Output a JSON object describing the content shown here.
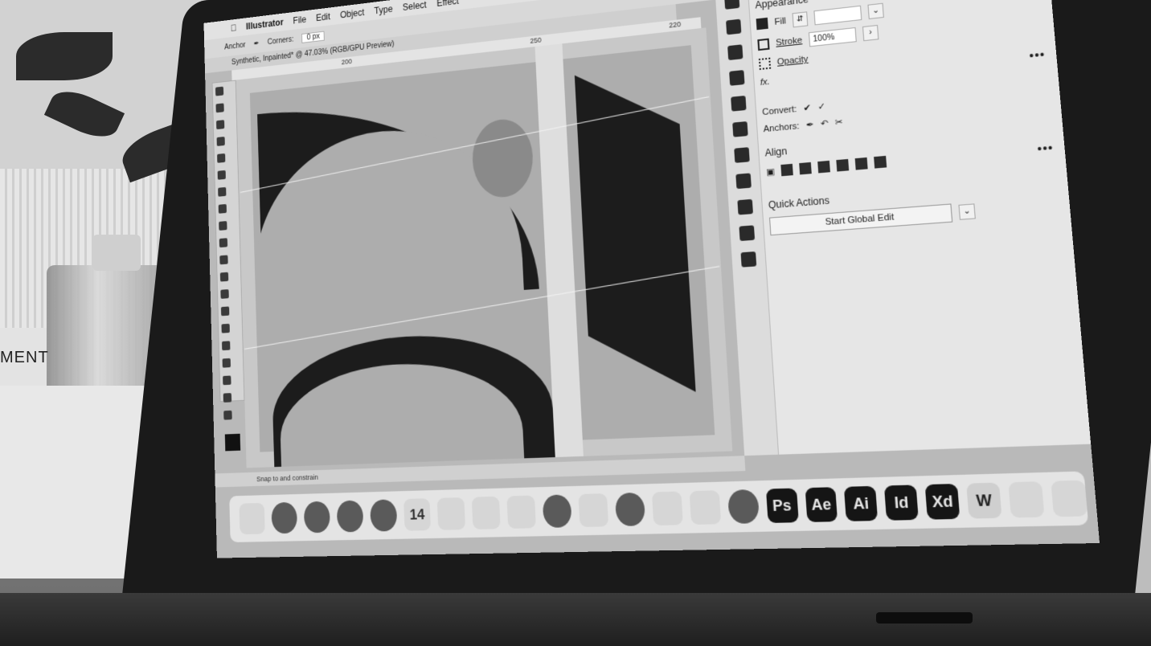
{
  "background": {
    "label_card_text": "MENT"
  },
  "menubar": {
    "items": [
      "Illustrator",
      "File",
      "Edit",
      "Object",
      "Type",
      "Select",
      "Effect"
    ]
  },
  "controlbar": {
    "items": [
      "Anchor",
      "Corners:",
      "0 px"
    ]
  },
  "docbar": {
    "title": "Synthetic, Inpainted* @ 47.03% (RGB/GPU Preview)"
  },
  "ruler": {
    "ticks": [
      "200",
      "250",
      "220"
    ]
  },
  "properties": {
    "appearance_title": "Appearance",
    "fill_label": "Fill",
    "stroke_label": "Stroke",
    "opacity_label": "Opacity",
    "opacity_value": "100%",
    "fx_label": "fx.",
    "convert_label": "Convert:",
    "anchors_label": "Anchors:",
    "align_title": "Align",
    "quick_actions_title": "Quick Actions",
    "start_global_edit": "Start Global Edit"
  },
  "statusbar": {
    "text": "Snap to and constrain"
  },
  "dock": {
    "icons": [
      {
        "name": "finder-icon",
        "label": ""
      },
      {
        "name": "launchpad-icon",
        "label": ""
      },
      {
        "name": "safari-icon",
        "label": ""
      },
      {
        "name": "messages-icon",
        "label": ""
      },
      {
        "name": "chrome-icon",
        "label": ""
      },
      {
        "name": "calendar-icon",
        "label": "14"
      },
      {
        "name": "notes-icon",
        "label": ""
      },
      {
        "name": "reminders-icon",
        "label": ""
      },
      {
        "name": "maps-icon",
        "label": ""
      },
      {
        "name": "photos-icon",
        "label": ""
      },
      {
        "name": "facetime-icon",
        "label": ""
      },
      {
        "name": "spotify-icon",
        "label": ""
      },
      {
        "name": "news-icon",
        "label": ""
      },
      {
        "name": "keynote-icon",
        "label": ""
      },
      {
        "name": "system-preferences-icon",
        "label": ""
      },
      {
        "name": "photoshop-icon",
        "label": "Ps"
      },
      {
        "name": "after-effects-icon",
        "label": "Ae"
      },
      {
        "name": "illustrator-icon",
        "label": "Ai"
      },
      {
        "name": "indesign-icon",
        "label": "Id"
      },
      {
        "name": "xd-icon",
        "label": "Xd"
      },
      {
        "name": "word-icon",
        "label": "W"
      },
      {
        "name": "screenshot-stack-icon",
        "label": ""
      },
      {
        "name": "trash-icon",
        "label": ""
      }
    ]
  }
}
